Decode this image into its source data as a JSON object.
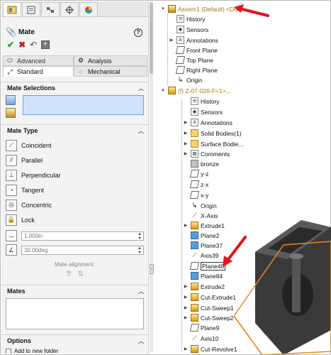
{
  "property_manager": {
    "title": "Mate",
    "help": "?",
    "tabs": [
      "feature-manager",
      "property-manager",
      "configuration-manager",
      "dimxpert-manager",
      "display-manager"
    ],
    "subtabs": {
      "advanced": "Advanced",
      "analysis": "Analysis",
      "standard": "Standard",
      "mechanical": "Mechanical"
    },
    "mate_selections": {
      "label": "Mate Selections"
    },
    "mate_type": {
      "label": "Mate Type",
      "items": [
        {
          "label": "Coincident"
        },
        {
          "label": "Parallel"
        },
        {
          "label": "Perpendicular"
        },
        {
          "label": "Tangent"
        },
        {
          "label": "Concentric"
        },
        {
          "label": "Lock"
        }
      ],
      "distance_value": "1.000in",
      "angle_value": "30.00deg",
      "alignment_label": "Mate alignment:"
    },
    "mates": {
      "label": "Mates"
    },
    "options": {
      "label": "Options",
      "add_folder": "Add to new folder"
    }
  },
  "tree": {
    "root": "Assem1 (Default) <Dis...",
    "items": [
      {
        "label": "History"
      },
      {
        "label": "Sensors"
      },
      {
        "label": "Annotations"
      },
      {
        "label": "Front Plane"
      },
      {
        "label": "Top Plane"
      },
      {
        "label": "Right Plane"
      },
      {
        "label": "Origin"
      },
      {
        "label": "(f) Z-07-026-F<1>..."
      },
      {
        "label": "History"
      },
      {
        "label": "Sensors"
      },
      {
        "label": "Annotations"
      },
      {
        "label": "Solid Bodies(1)"
      },
      {
        "label": "Surface Bodie..."
      },
      {
        "label": "Comments"
      },
      {
        "label": "bronze"
      },
      {
        "label": "y-z"
      },
      {
        "label": "z-x"
      },
      {
        "label": "x-y"
      },
      {
        "label": "Origin"
      },
      {
        "label": "X-Axis"
      },
      {
        "label": "Extrude1"
      },
      {
        "label": "Plane2"
      },
      {
        "label": "Plane37"
      },
      {
        "label": "Axis39"
      },
      {
        "label": "Plane40"
      },
      {
        "label": "Plane84"
      },
      {
        "label": "Extrude2"
      },
      {
        "label": "Cut-Extrude1"
      },
      {
        "label": "Cut-Sweep1"
      },
      {
        "label": "Cut-Sweep2"
      },
      {
        "label": "Plane9"
      },
      {
        "label": "Axis10"
      },
      {
        "label": "Cut-Revolve1"
      }
    ]
  },
  "colors": {
    "accent_red": "#e0141e",
    "selection_blue": "#cfe4fb",
    "assembly_text": "#9c7a10",
    "plane_orange": "#e8871e"
  }
}
